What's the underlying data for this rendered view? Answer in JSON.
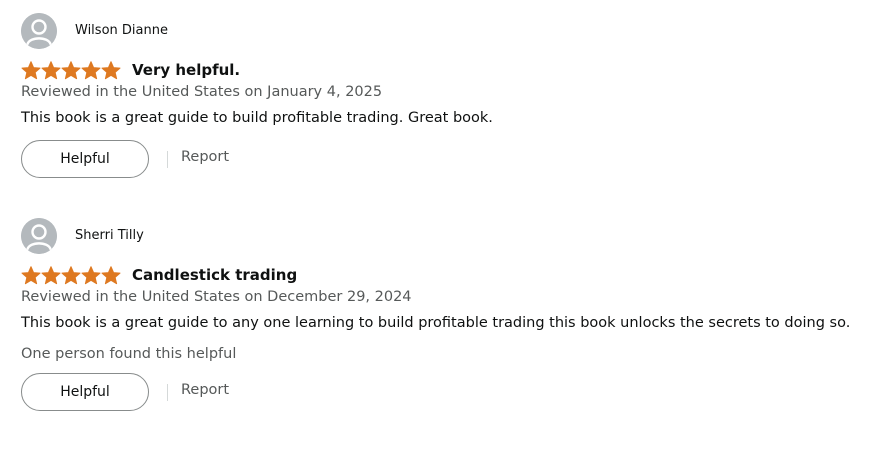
{
  "colors": {
    "star": "#de7921",
    "avatar_bg": "#b4b9bd",
    "secondary_text": "#565959",
    "primary_text": "#0f1111"
  },
  "reviews": [
    {
      "profile_name": "Wilson Dianne",
      "rating": 5,
      "title": "Very helpful.",
      "date": "Reviewed in the United States on January 4, 2025",
      "body": "This book is a great guide to build profitable trading. Great book.",
      "helpful_stat": "",
      "helpful_label": "Helpful",
      "report_label": "Report"
    },
    {
      "profile_name": "Sherri Tilly",
      "rating": 5,
      "title": "Candlestick trading",
      "date": "Reviewed in the United States on December 29, 2024",
      "body": "This book is a great guide to any one learning to build profitable trading this book unlocks the secrets to doing so.",
      "helpful_stat": "One person found this helpful",
      "helpful_label": "Helpful",
      "report_label": "Report"
    }
  ]
}
